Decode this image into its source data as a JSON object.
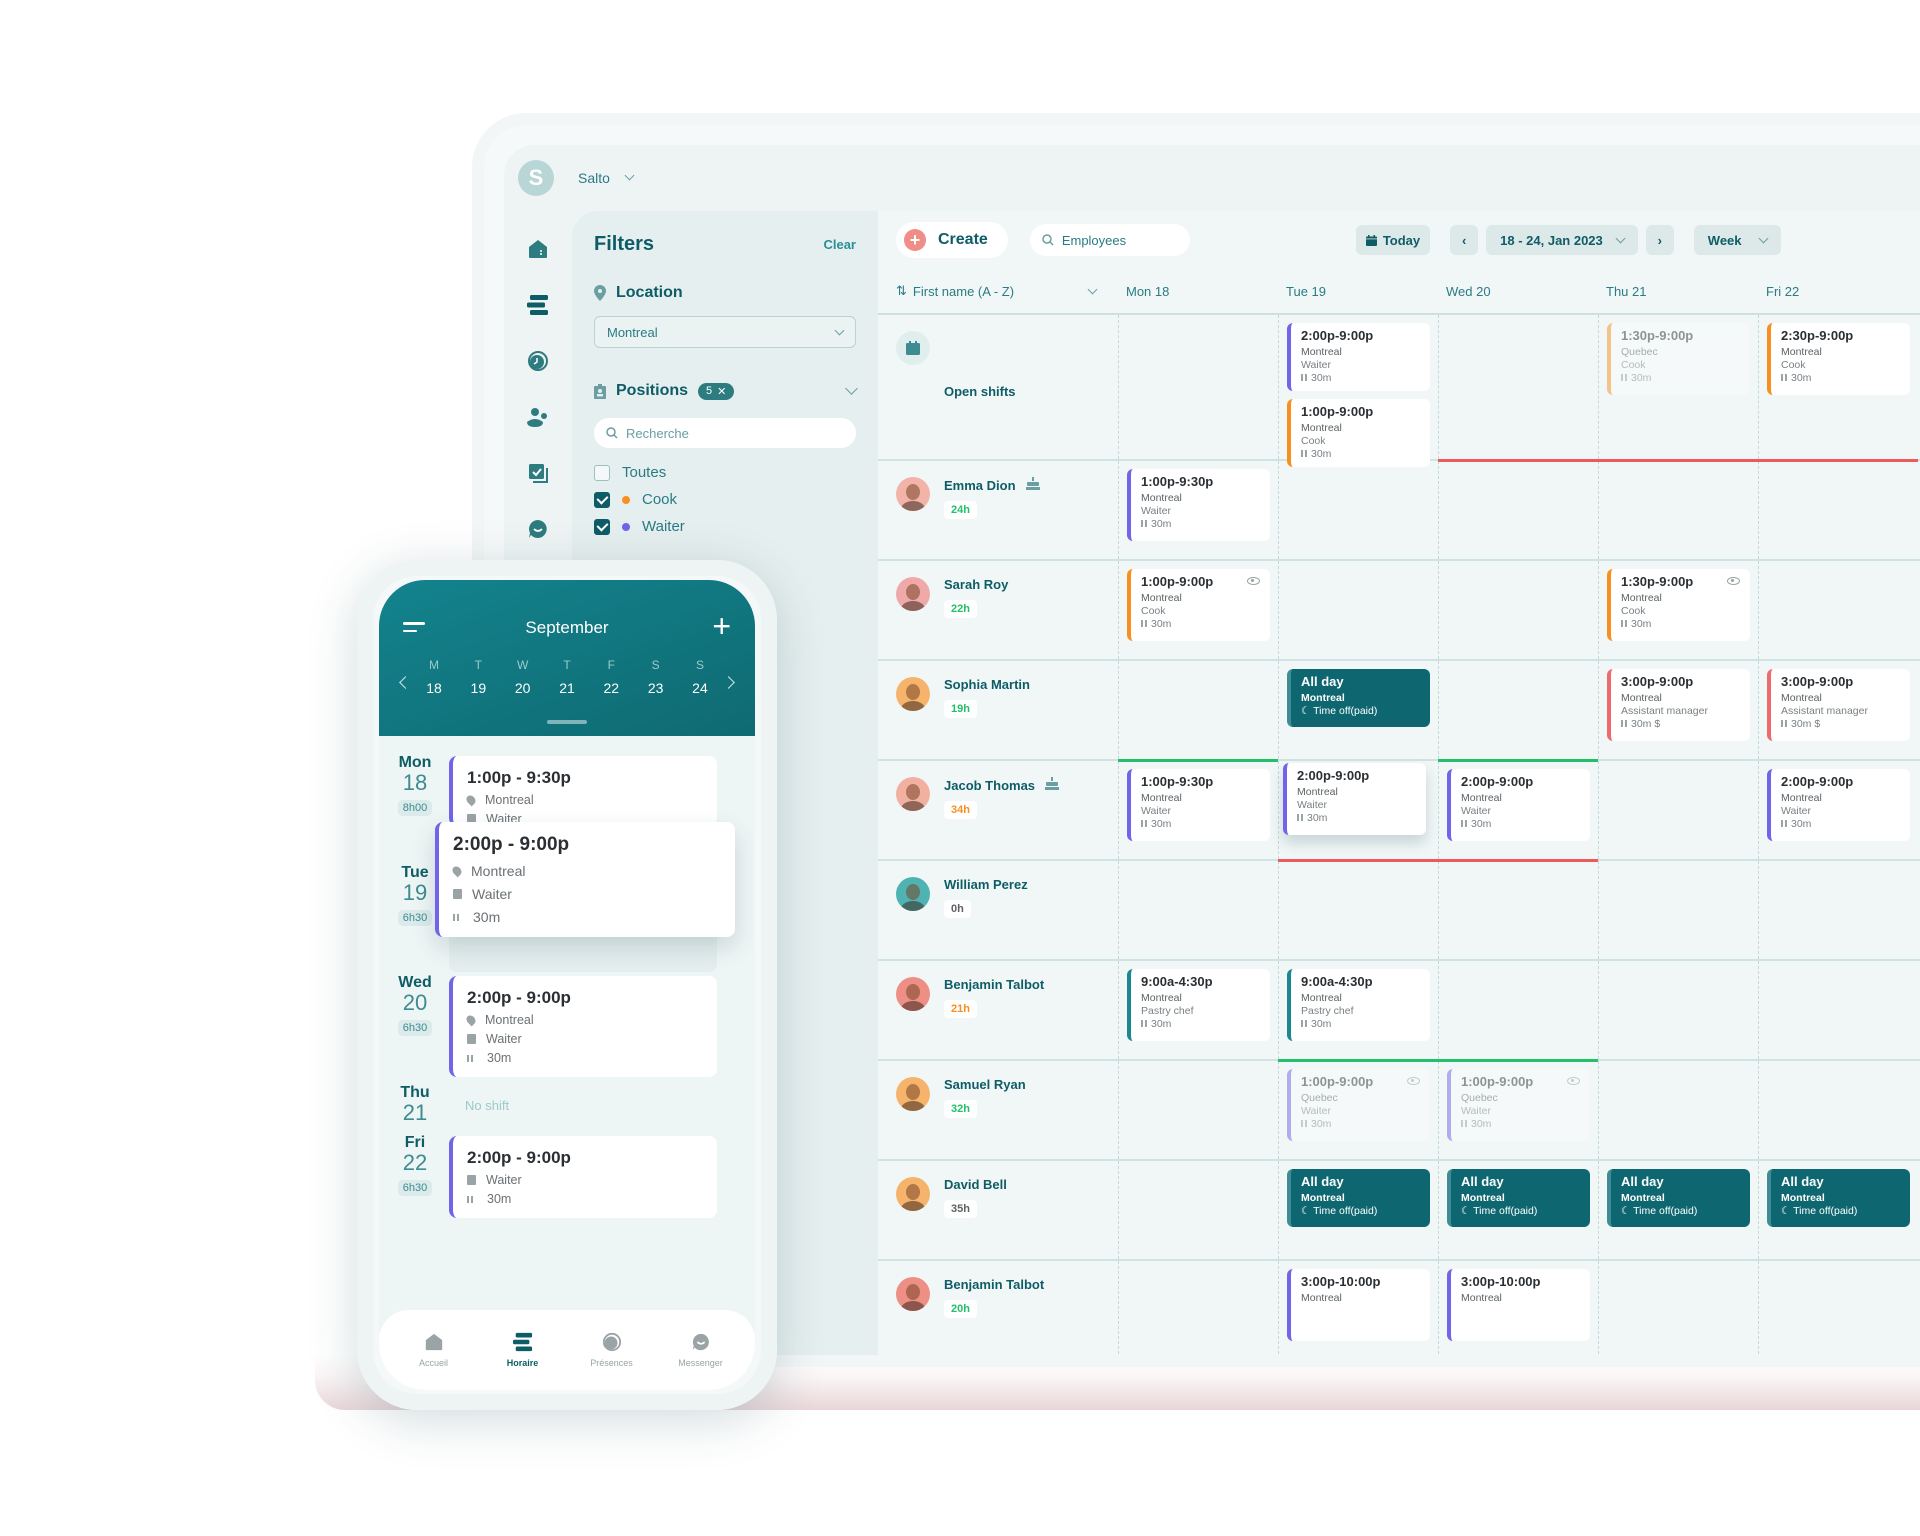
{
  "app": {
    "org_initial": "S",
    "org_name": "Salto"
  },
  "colors": {
    "brand": "#0e5c66",
    "accent_create": "#f08d86",
    "cook": "#f7901e",
    "waiter": "#7164e8",
    "assistant_manager": "#ef6a6a",
    "pastry_chef": "#1a8891",
    "time_off": "#0e6670",
    "under_hours": "#22c06a",
    "over_hours": "#f7901e"
  },
  "sidebar": {
    "items": [
      {
        "name": "home",
        "label": "Accueil"
      },
      {
        "name": "schedule",
        "label": "Horaire"
      },
      {
        "name": "time-clock",
        "label": "Présences"
      },
      {
        "name": "team",
        "label": "Team"
      },
      {
        "name": "tasks",
        "label": "Tasks"
      },
      {
        "name": "messenger",
        "label": "Messenger"
      }
    ]
  },
  "filters": {
    "title": "Filters",
    "clear_label": "Clear",
    "location": {
      "label": "Location",
      "selected": "Montreal"
    },
    "positions": {
      "label": "Positions",
      "count": "5",
      "search_placeholder": "Recherche",
      "options": [
        {
          "label": "Toutes",
          "checked": false,
          "color": ""
        },
        {
          "label": "Cook",
          "checked": true,
          "color": "#f7901e"
        },
        {
          "label": "Waiter",
          "checked": true,
          "color": "#7164e8"
        }
      ]
    }
  },
  "toolbar": {
    "create_label": "Create",
    "search_placeholder": "Employees",
    "today_label": "Today",
    "date_range": "18 - 24, Jan 2023",
    "view": "Week"
  },
  "grid": {
    "sort_label": "First name (A - Z)",
    "days": [
      "Mon 18",
      "Tue 19",
      "Wed 20",
      "Thu 21",
      "Fri 22"
    ],
    "open_shifts_label": "Open shifts",
    "open_shifts": [
      [],
      [
        {
          "time": "2:00p-9:00p",
          "location": "Montreal",
          "role": "Waiter",
          "break": "30m",
          "color": "#7164e8"
        },
        {
          "time": "1:00p-9:00p",
          "location": "Montreal",
          "role": "Cook",
          "break": "30m",
          "color": "#f7901e"
        }
      ],
      [],
      [
        {
          "time": "1:30p-9:00p",
          "location": "Quebec",
          "role": "Cook",
          "break": "30m",
          "color": "#f7901e",
          "faded": true
        }
      ],
      [
        {
          "time": "2:30p-9:00p",
          "location": "Montreal",
          "role": "Cook",
          "break": "30m",
          "color": "#f7901e"
        }
      ]
    ],
    "employees": [
      {
        "name": "Emma Dion",
        "hours": "24h",
        "hours_status": "under",
        "birthday": true,
        "avatar_color": "#f2b3a8",
        "shifts": [
          [
            {
              "time": "1:00p-9:30p",
              "location": "Montreal",
              "role": "Waiter",
              "break": "30m",
              "color": "#7164e8"
            }
          ],
          [],
          [],
          [],
          []
        ]
      },
      {
        "name": "Sarah Roy",
        "hours": "22h",
        "hours_status": "under",
        "birthday": false,
        "avatar_color": "#f0a9a9",
        "shifts": [
          [
            {
              "time": "1:00p-9:00p",
              "location": "Montreal",
              "role": "Cook",
              "break": "30m",
              "color": "#f7901e",
              "eye": true
            }
          ],
          [],
          [],
          [
            {
              "time": "1:30p-9:00p",
              "location": "Montreal",
              "role": "Cook",
              "break": "30m",
              "color": "#f7901e",
              "eye": true
            }
          ],
          []
        ]
      },
      {
        "name": "Sophia Martin",
        "hours": "19h",
        "hours_status": "under",
        "birthday": false,
        "avatar_color": "#f5b36b",
        "shifts": [
          [],
          [
            {
              "time": "All day",
              "location": "Montreal",
              "role": "Time off(paid)",
              "timeoff": true
            }
          ],
          [],
          [
            {
              "time": "3:00p-9:00p",
              "location": "Montreal",
              "role": "Assistant manager",
              "break": "30m $",
              "color": "#ef6a6a"
            }
          ],
          [
            {
              "time": "3:00p-9:00p",
              "location": "Montreal",
              "role": "Assistant manager",
              "break": "30m $",
              "color": "#ef6a6a"
            }
          ]
        ]
      },
      {
        "name": "Jacob Thomas",
        "hours": "34h",
        "hours_status": "over",
        "birthday": true,
        "avatar_color": "#f2b0a0",
        "shifts": [
          [
            {
              "time": "1:00p-9:30p",
              "location": "Montreal",
              "role": "Waiter",
              "break": "30m",
              "color": "#7164e8"
            }
          ],
          [
            {
              "time": "2:00p-9:00p",
              "location": "Montreal",
              "role": "Waiter",
              "break": "30m",
              "color": "#7164e8",
              "lifted": true
            }
          ],
          [
            {
              "time": "2:00p-9:00p",
              "location": "Montreal",
              "role": "Waiter",
              "break": "30m",
              "color": "#7164e8"
            }
          ],
          [],
          [
            {
              "time": "2:00p-9:00p",
              "location": "Montreal",
              "role": "Waiter",
              "break": "30m",
              "color": "#7164e8"
            }
          ]
        ]
      },
      {
        "name": "William Perez",
        "hours": "0h",
        "hours_status": "none",
        "birthday": false,
        "avatar_color": "#4fb3b3",
        "shifts": [
          [],
          [],
          [],
          [],
          []
        ]
      },
      {
        "name": "Benjamin Talbot",
        "hours": "21h",
        "hours_status": "over",
        "birthday": false,
        "avatar_color": "#ee8f86",
        "shifts": [
          [
            {
              "time": "9:00a-4:30p",
              "location": "Montreal",
              "role": "Pastry chef",
              "break": "30m",
              "color": "#1a8891"
            }
          ],
          [
            {
              "time": "9:00a-4:30p",
              "location": "Montreal",
              "role": "Pastry chef",
              "break": "30m",
              "color": "#1a8891"
            }
          ],
          [],
          [],
          []
        ]
      },
      {
        "name": "Samuel Ryan",
        "hours": "32h",
        "hours_status": "under",
        "birthday": false,
        "avatar_color": "#f5b36b",
        "shifts": [
          [],
          [
            {
              "time": "1:00p-9:00p",
              "location": "Quebec",
              "role": "Waiter",
              "break": "30m",
              "color": "#7164e8",
              "eye": true,
              "faded": true
            }
          ],
          [
            {
              "time": "1:00p-9:00p",
              "location": "Quebec",
              "role": "Waiter",
              "break": "30m",
              "color": "#7164e8",
              "eye": true,
              "faded": true
            }
          ],
          [],
          []
        ]
      },
      {
        "name": "David Bell",
        "hours": "35h",
        "hours_status": "none",
        "birthday": false,
        "avatar_color": "#f5b36b",
        "shifts": [
          [],
          [
            {
              "time": "All day",
              "location": "Montreal",
              "role": "Time off(paid)",
              "timeoff": true
            }
          ],
          [
            {
              "time": "All day",
              "location": "Montreal",
              "role": "Time off(paid)",
              "timeoff": true
            }
          ],
          [
            {
              "time": "All day",
              "location": "Montreal",
              "role": "Time off(paid)",
              "timeoff": true
            }
          ],
          [
            {
              "time": "All day",
              "location": "Montreal",
              "role": "Time off(paid)",
              "timeoff": true
            }
          ]
        ]
      },
      {
        "name": "Benjamin Talbot",
        "hours": "20h",
        "hours_status": "under",
        "birthday": false,
        "avatar_color": "#ee8f86",
        "shifts": [
          [],
          [
            {
              "time": "3:00p-10:00p",
              "location": "Montreal",
              "role": "",
              "break": "",
              "color": "#7164e8"
            }
          ],
          [
            {
              "time": "3:00p-10:00p",
              "location": "Montreal",
              "role": "",
              "break": "",
              "color": "#7164e8"
            }
          ],
          [],
          []
        ]
      }
    ]
  },
  "phone": {
    "month": "September",
    "week": [
      {
        "letter": "M",
        "num": "18"
      },
      {
        "letter": "T",
        "num": "19"
      },
      {
        "letter": "W",
        "num": "20"
      },
      {
        "letter": "T",
        "num": "21"
      },
      {
        "letter": "F",
        "num": "22"
      },
      {
        "letter": "S",
        "num": "23"
      },
      {
        "letter": "S",
        "num": "24"
      }
    ],
    "days": [
      {
        "dow": "Mon",
        "num": "18",
        "hours": "8h00",
        "shift": {
          "time": "1:00p - 9:30p",
          "location": "Montreal",
          "role": "Waiter"
        }
      },
      {
        "dow": "Tue",
        "num": "19",
        "hours": "6h30",
        "shift": {
          "time": "2:00p - 9:00p",
          "location": "Montreal",
          "role": "Waiter",
          "break": "30m"
        }
      },
      {
        "dow": "Wed",
        "num": "20",
        "hours": "6h30",
        "shift": {
          "time": "2:00p - 9:00p",
          "location": "Montreal",
          "role": "Waiter",
          "break": "30m"
        }
      },
      {
        "dow": "Thu",
        "num": "21",
        "no_shift": "No shift"
      },
      {
        "dow": "Fri",
        "num": "22",
        "hours": "6h30",
        "shift": {
          "time": "2:00p - 9:00p",
          "role": "Waiter",
          "break": "30m"
        }
      }
    ],
    "tabs": [
      {
        "label": "Accueil",
        "active": false
      },
      {
        "label": "Horaire",
        "active": true
      },
      {
        "label": "Présences",
        "active": false
      },
      {
        "label": "Messenger",
        "active": false
      }
    ]
  }
}
